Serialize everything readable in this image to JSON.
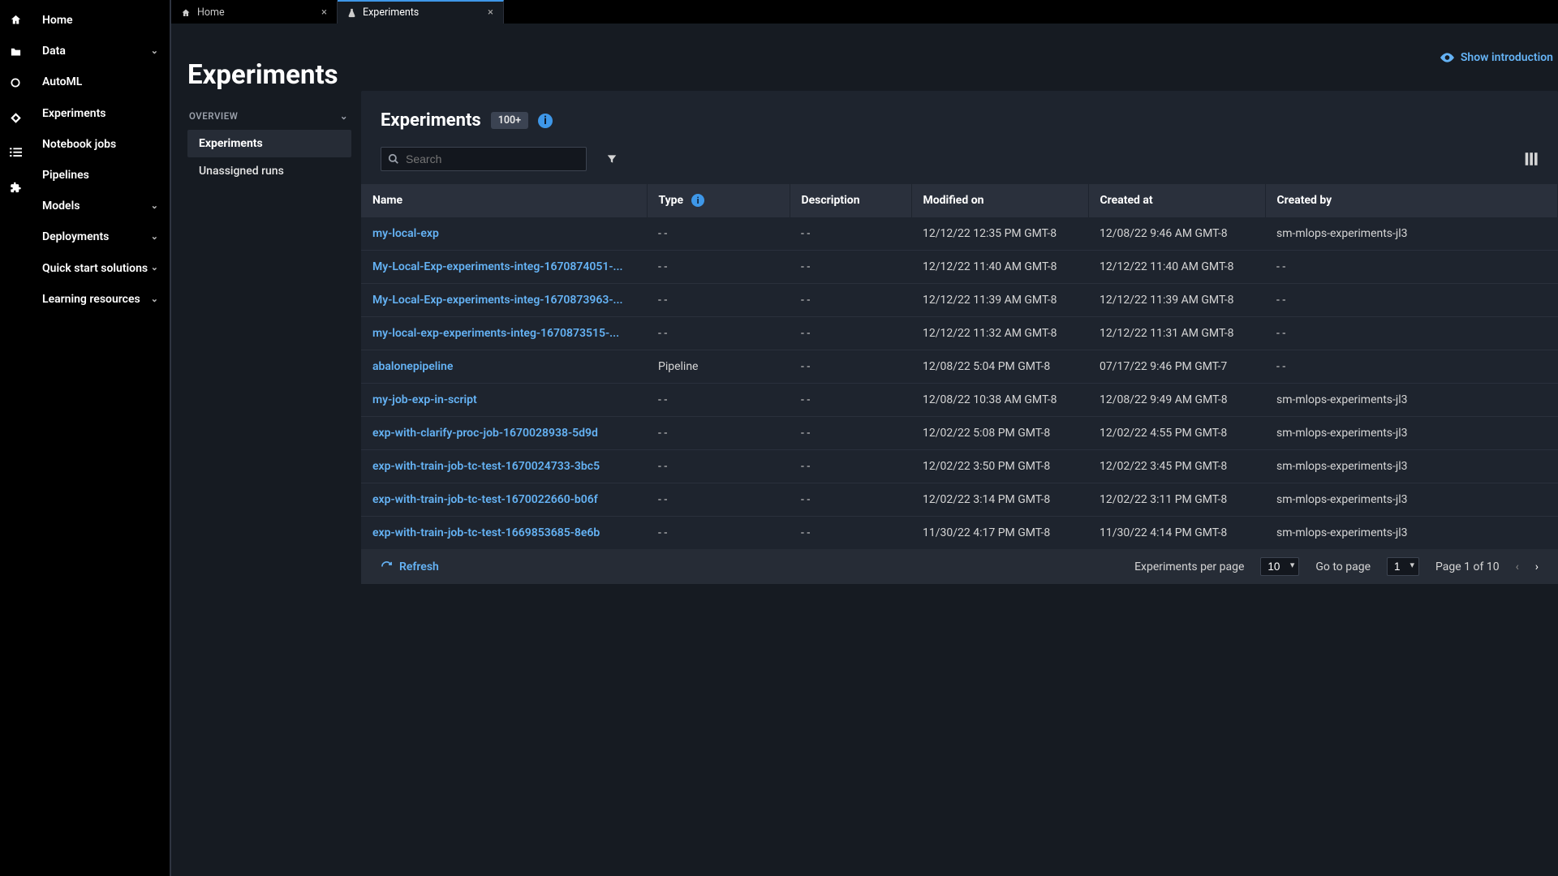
{
  "sidebar": {
    "items": [
      {
        "label": "Home",
        "expandable": false
      },
      {
        "label": "Data",
        "expandable": true
      },
      {
        "label": "AutoML",
        "expandable": false
      },
      {
        "label": "Experiments",
        "expandable": false
      },
      {
        "label": "Notebook jobs",
        "expandable": false
      },
      {
        "label": "Pipelines",
        "expandable": false
      },
      {
        "label": "Models",
        "expandable": true
      },
      {
        "label": "Deployments",
        "expandable": true
      },
      {
        "label": "Quick start solutions",
        "expandable": true
      },
      {
        "label": "Learning resources",
        "expandable": true
      }
    ]
  },
  "tabs": [
    {
      "label": "Home",
      "active": false
    },
    {
      "label": "Experiments",
      "active": true
    }
  ],
  "page": {
    "title": "Experiments",
    "show_intro": "Show introduction"
  },
  "overview": {
    "header": "OVERVIEW",
    "items": [
      {
        "label": "Experiments",
        "active": true
      },
      {
        "label": "Unassigned runs",
        "active": false
      }
    ]
  },
  "panel": {
    "title": "Experiments",
    "count_badge": "100+",
    "search_placeholder": "Search",
    "refresh_label": "Refresh",
    "per_page_label": "Experiments per page",
    "per_page_value": "10",
    "goto_label": "Go to page",
    "goto_value": "1",
    "page_of": "Page 1 of 10"
  },
  "columns": {
    "name": "Name",
    "type": "Type",
    "description": "Description",
    "modified": "Modified on",
    "created_at": "Created at",
    "created_by": "Created by"
  },
  "rows": [
    {
      "name": "my-local-exp",
      "type": "- -",
      "desc": "- -",
      "mod": "12/12/22 12:35 PM GMT-8",
      "created": "12/08/22 9:46 AM GMT-8",
      "by": "sm-mlops-experiments-jl3"
    },
    {
      "name": "My-Local-Exp-experiments-integ-1670874051-...",
      "type": "- -",
      "desc": "- -",
      "mod": "12/12/22 11:40 AM GMT-8",
      "created": "12/12/22 11:40 AM GMT-8",
      "by": "- -"
    },
    {
      "name": "My-Local-Exp-experiments-integ-1670873963-...",
      "type": "- -",
      "desc": "- -",
      "mod": "12/12/22 11:39 AM GMT-8",
      "created": "12/12/22 11:39 AM GMT-8",
      "by": "- -"
    },
    {
      "name": "my-local-exp-experiments-integ-1670873515-...",
      "type": "- -",
      "desc": "- -",
      "mod": "12/12/22 11:32 AM GMT-8",
      "created": "12/12/22 11:31 AM GMT-8",
      "by": "- -"
    },
    {
      "name": "abalonepipeline",
      "type": "Pipeline",
      "desc": "- -",
      "mod": "12/08/22 5:04 PM GMT-8",
      "created": "07/17/22 9:46 PM GMT-7",
      "by": "- -"
    },
    {
      "name": "my-job-exp-in-script",
      "type": "- -",
      "desc": "- -",
      "mod": "12/08/22 10:38 AM GMT-8",
      "created": "12/08/22 9:49 AM GMT-8",
      "by": "sm-mlops-experiments-jl3"
    },
    {
      "name": "exp-with-clarify-proc-job-1670028938-5d9d",
      "type": "- -",
      "desc": "- -",
      "mod": "12/02/22 5:08 PM GMT-8",
      "created": "12/02/22 4:55 PM GMT-8",
      "by": "sm-mlops-experiments-jl3"
    },
    {
      "name": "exp-with-train-job-tc-test-1670024733-3bc5",
      "type": "- -",
      "desc": "- -",
      "mod": "12/02/22 3:50 PM GMT-8",
      "created": "12/02/22 3:45 PM GMT-8",
      "by": "sm-mlops-experiments-jl3"
    },
    {
      "name": "exp-with-train-job-tc-test-1670022660-b06f",
      "type": "- -",
      "desc": "- -",
      "mod": "12/02/22 3:14 PM GMT-8",
      "created": "12/02/22 3:11 PM GMT-8",
      "by": "sm-mlops-experiments-jl3"
    },
    {
      "name": "exp-with-train-job-tc-test-1669853685-8e6b",
      "type": "- -",
      "desc": "- -",
      "mod": "11/30/22 4:17 PM GMT-8",
      "created": "11/30/22 4:14 PM GMT-8",
      "by": "sm-mlops-experiments-jl3"
    }
  ]
}
